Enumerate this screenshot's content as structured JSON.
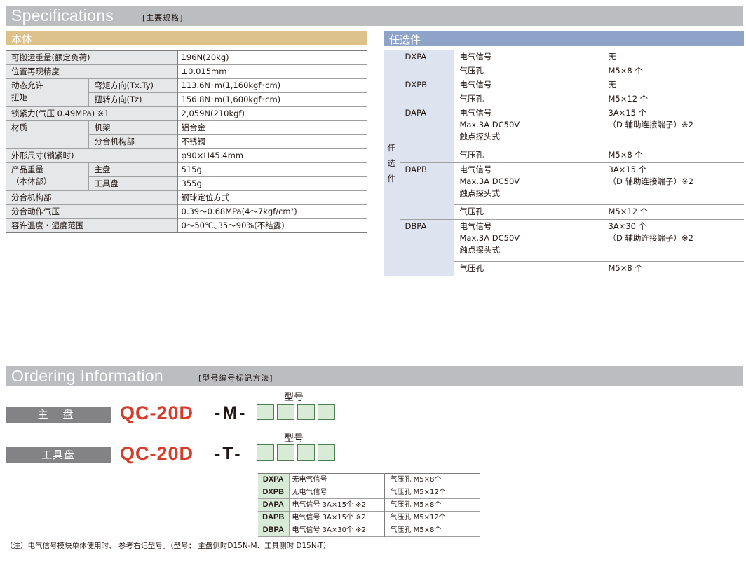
{
  "specifications": {
    "title": "Specifications",
    "subtitle": "[主要规格]",
    "body_header": "本体",
    "options_header": "任选件",
    "spec_rows": [
      {
        "label": "可搬运重量(额定负荷)",
        "value": "196N(20kg)"
      },
      {
        "label": "位置再现精度",
        "value": "±0.015mm"
      },
      {
        "label": "动态允许\n扭矩",
        "sub": [
          {
            "label": "弯矩方向(Tx.Ty)",
            "value": "113.6N･m(1,160kgf･cm)"
          },
          {
            "label": "扭转方向(Tz)",
            "value": "156.8N･m(1,600kgf･cm)"
          }
        ]
      },
      {
        "label": "锁紧力(气压 0.49MPa) ※1",
        "value": "2,059N(210kgf)"
      },
      {
        "label": "材质",
        "sub": [
          {
            "label": "机架",
            "value": "铝合金"
          },
          {
            "label": "分合机构部",
            "value": "不锈钢"
          }
        ]
      },
      {
        "label": "外形尺寸(锁紧时)",
        "value": "φ90×H45.4mm"
      },
      {
        "label": "产品重量\n（本体部）",
        "sub": [
          {
            "label": "主盘",
            "value": "515g"
          },
          {
            "label": "工具盘",
            "value": "355g"
          }
        ]
      },
      {
        "label": "分合机构部",
        "value": "钢球定位方式"
      },
      {
        "label": "分合动作气压",
        "value": "0.39～0.68MPa(4～7kgf/cm²)"
      },
      {
        "label": "容许温度・湿度范围",
        "value": "0～50℃､35～90%(不结露)"
      }
    ],
    "options_side": "任\n选\n件",
    "options": [
      {
        "model": "DXPA",
        "rows": [
          {
            "item": "电气信号",
            "value": "无"
          },
          {
            "item": "气压孔",
            "value": "M5×8 个"
          }
        ]
      },
      {
        "model": "DXPB",
        "rows": [
          {
            "item": "电气信号",
            "value": "无"
          },
          {
            "item": "气压孔",
            "value": "M5×12 个"
          }
        ]
      },
      {
        "model": "DAPA",
        "rows": [
          {
            "item": "电气信号\nMax.3A DC50V\n触点探头式",
            "value": "3A×15 个\n（D 辅助连接端子）※2"
          },
          {
            "item": "气压孔",
            "value": "M5×8 个"
          }
        ]
      },
      {
        "model": "DAPB",
        "rows": [
          {
            "item": "电气信号\nMax.3A DC50V\n触点探头式",
            "value": "3A×15 个\n（D 辅助连接端子）※2"
          },
          {
            "item": "气压孔",
            "value": "M5×12 个"
          }
        ]
      },
      {
        "model": "DBPA",
        "rows": [
          {
            "item": "电气信号\nMax.3A DC50V\n触点探头式",
            "value": "3A×30 个\n（D 辅助连接端子）※2"
          },
          {
            "item": "气压孔",
            "value": "M5×8 个"
          }
        ]
      }
    ]
  },
  "ordering": {
    "title": "Ordering Information",
    "subtitle": "[型号编号标记方法]",
    "type_label": "型号",
    "master": {
      "label": "主 盘",
      "code": "QC-20D",
      "suffix": "-M-"
    },
    "tool": {
      "label": "工具盘",
      "code": "QC-20D",
      "suffix": "-T-"
    },
    "table": [
      {
        "code": "DXPA",
        "desc": "无电气信号",
        "hole": "气压孔 M5×8个"
      },
      {
        "code": "DXPB",
        "desc": "无电气信号",
        "hole": "气压孔 M5×12个"
      },
      {
        "code": "DAPA",
        "desc": "电气信号 3A×15个 ※2",
        "hole": "气压孔 M5×8个"
      },
      {
        "code": "DAPB",
        "desc": "电气信号 3A×15个 ※2",
        "hole": "气压孔 M5×12个"
      },
      {
        "code": "DBPA",
        "desc": "电气信号 3A×30个 ※2",
        "hole": "气压孔 M5×8个"
      }
    ],
    "note": "（注）电气信号模块单体使用时、 参考右记型号。（型号： 主盘侧时D15N-M、工具侧时 D15N-T）"
  }
}
